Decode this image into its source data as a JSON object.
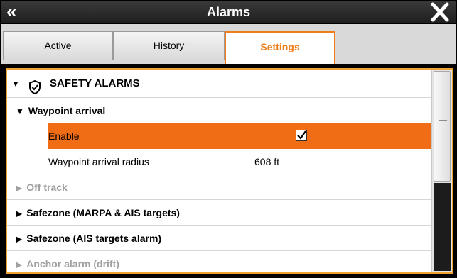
{
  "window": {
    "title": "Alarms"
  },
  "tabs": [
    {
      "label": "Active"
    },
    {
      "label": "History"
    },
    {
      "label": "Settings"
    }
  ],
  "section": {
    "title": "SAFETY ALARMS"
  },
  "groups": {
    "waypoint": {
      "label": "Waypoint arrival",
      "enable_label": "Enable",
      "enable_checked": true,
      "radius_label": "Waypoint arrival radius",
      "radius_value": "608 ft"
    },
    "off_track": {
      "label": "Off track"
    },
    "safezone_marpa": {
      "label": "Safezone (MARPA & AIS targets)"
    },
    "safezone_ais": {
      "label": "Safezone (AIS targets alarm)"
    },
    "anchor": {
      "label": "Anchor alarm (drift)"
    }
  },
  "colors": {
    "accent": "#f07d1a",
    "highlight": "#f06c15",
    "panel_border": "#f0a232",
    "disabled_text": "#a0a0a0"
  }
}
